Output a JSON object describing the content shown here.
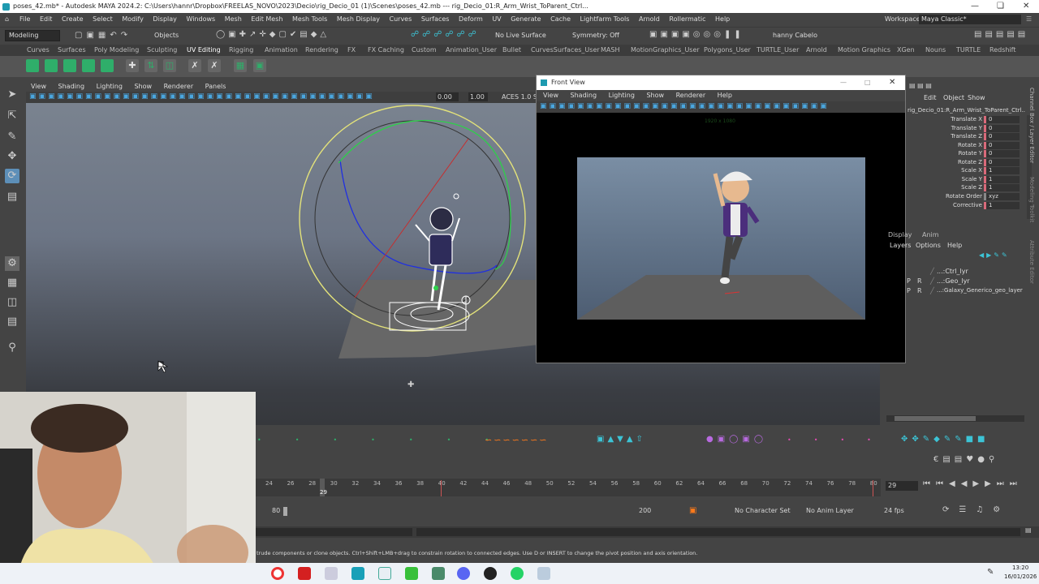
{
  "window": {
    "title": "poses_42.mb* - Autodesk MAYA 2024.2: C:\\Users\\hannr\\Dropbox\\FREELAS_NOVO\\2023\\Decio\\rig_Decio_01 (1)\\Scenes\\poses_42.mb  ---  rig_Decio_01:R_Arm_Wrist_ToParent_Ctrl...",
    "workspace_label": "Workspace:",
    "workspace_value": "Maya Classic*"
  },
  "menubar": [
    "File",
    "Edit",
    "Create",
    "Select",
    "Modify",
    "Display",
    "Windows",
    "Mesh",
    "Edit Mesh",
    "Mesh Tools",
    "Mesh Display",
    "Curves",
    "Surfaces",
    "Deform",
    "UV",
    "Generate",
    "Cache",
    "Lightfarm Tools",
    "Arnold",
    "Rollermatic",
    "Help"
  ],
  "statusline": {
    "mode": "Modeling",
    "objects": "Objects",
    "live_surface": "No Live Surface",
    "symmetry": "Symmetry: Off",
    "user": "hanny Cabelo"
  },
  "shelf_tabs": [
    "Curves",
    "Surfaces",
    "Poly Modeling",
    "Sculpting",
    "UV Editing",
    "Rigging",
    "Animation",
    "Rendering",
    "FX",
    "FX Caching",
    "Custom",
    "Animation_User",
    "Bullet",
    "CurvesSurfaces_User",
    "MASH",
    "MotionGraphics_User",
    "Polygons_User",
    "TURTLE_User",
    "Arnold",
    "Motion Graphics",
    "XGen",
    "Nouns",
    "TURTLE",
    "Redshift"
  ],
  "viewport": {
    "menu": [
      "View",
      "Shading",
      "Lighting",
      "Show",
      "Renderer",
      "Panels"
    ],
    "field_a": "0.00",
    "field_b": "1.00",
    "color_space": "ACES 1.0 SD"
  },
  "front_view": {
    "title": "Front View",
    "menu": [
      "View",
      "Shading",
      "Lighting",
      "Show",
      "Renderer",
      "Help"
    ],
    "resolution": "1920 x 1080"
  },
  "channel_box": {
    "menu": [
      "Edit",
      "Object",
      "Show"
    ],
    "node": "rig_Decio_01:R_Arm_Wrist_ToParent_Ctrl...",
    "channels": [
      {
        "name": "Translate X",
        "value": "0"
      },
      {
        "name": "Translate Y",
        "value": "0"
      },
      {
        "name": "Translate Z",
        "value": "0"
      },
      {
        "name": "Rotate X",
        "value": "0"
      },
      {
        "name": "Rotate Y",
        "value": "0"
      },
      {
        "name": "Rotate Z",
        "value": "0"
      },
      {
        "name": "Scale X",
        "value": "1"
      },
      {
        "name": "Scale Y",
        "value": "1"
      },
      {
        "name": "Scale Z",
        "value": "1"
      },
      {
        "name": "Rotate Order",
        "value": "xyz"
      },
      {
        "name": "Corrective",
        "value": "1"
      }
    ],
    "side_tabs": [
      "Channel Box / Layer Editor",
      "Modeling Toolkit",
      "Attribute Editor"
    ]
  },
  "layer_editor": {
    "tabs": [
      "Display",
      "Anim"
    ],
    "menu": [
      "Layers",
      "Options",
      "Help"
    ],
    "layers": [
      {
        "p": "",
        "r": "",
        "name": "...:Ctrl_lyr"
      },
      {
        "p": "P",
        "r": "R",
        "name": "...:Geo_lyr"
      },
      {
        "p": "P",
        "r": "R",
        "name": "...:Galaxy_Generico_geo_layer"
      }
    ]
  },
  "timeline": {
    "ticks": [
      "24",
      "26",
      "28",
      "30",
      "32",
      "34",
      "36",
      "38",
      "40",
      "42",
      "44",
      "46",
      "48",
      "50",
      "52",
      "54",
      "56",
      "58",
      "60",
      "62",
      "64",
      "66",
      "68",
      "70",
      "72",
      "74",
      "76",
      "78",
      "80"
    ],
    "current_frame_marker": "29",
    "current_frame": "29",
    "range_start": "80",
    "range_end": "200",
    "character_set": "No Character Set",
    "anim_layer": "No Anim Layer",
    "fps": "24 fps"
  },
  "help_line": "trude components or clone objects. Ctrl+Shift+LMB+drag to constrain rotation to connected edges. Use D or INSERT to change the pivot position and axis orientation.",
  "taskbar": {
    "time": "13:20",
    "date": "16/01/2026"
  }
}
